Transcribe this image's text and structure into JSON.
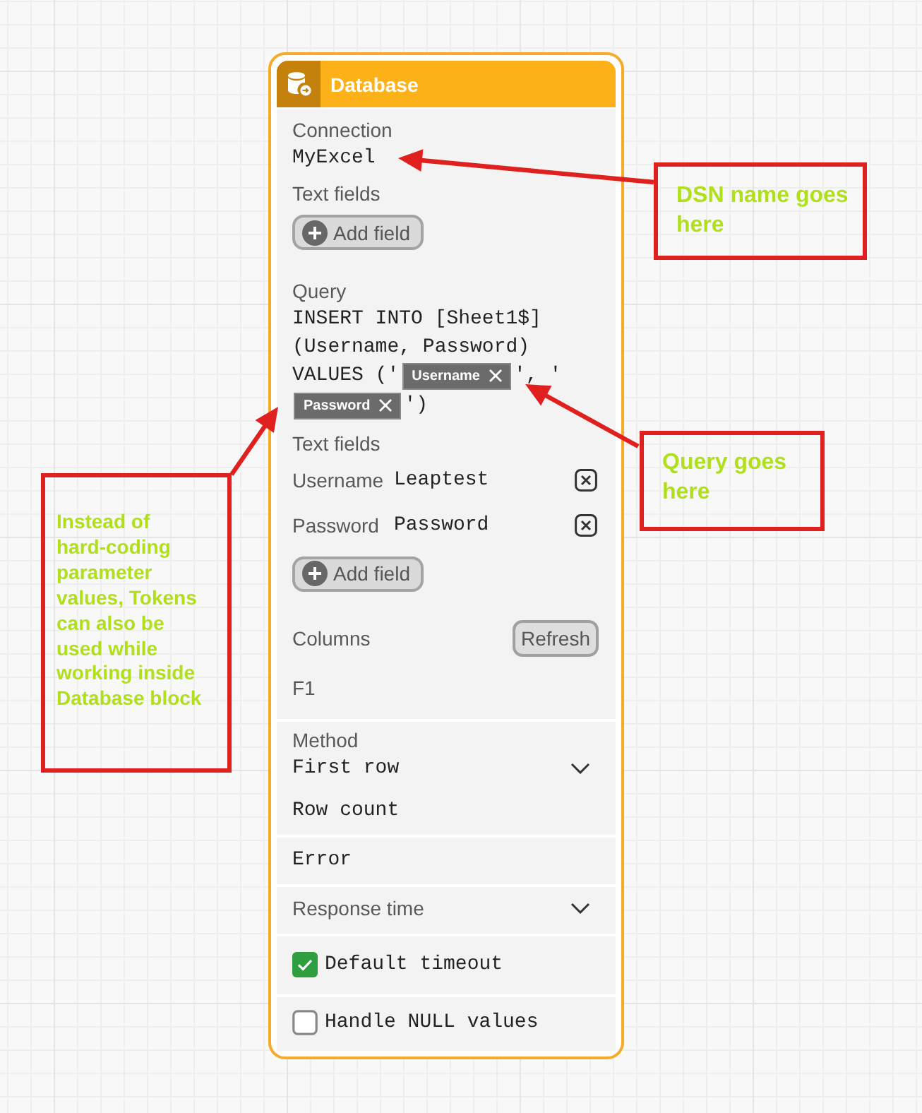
{
  "node": {
    "title": "Database",
    "connection": {
      "label": "Connection",
      "value": "MyExcel"
    },
    "connection_fields": {
      "label": "Text fields",
      "add_button": "Add field"
    },
    "query": {
      "label": "Query",
      "lines": [
        [
          {
            "kind": "text",
            "text": "INSERT INTO [Sheet1$]"
          }
        ],
        [
          {
            "kind": "text",
            "text": "(Username, Password)"
          }
        ],
        [
          {
            "kind": "text",
            "text": "VALUES ('"
          },
          {
            "kind": "token",
            "text": "Username"
          },
          {
            "kind": "text",
            "text": "', '"
          }
        ],
        [
          {
            "kind": "token",
            "text": "Password"
          },
          {
            "kind": "text",
            "text": "')"
          }
        ]
      ]
    },
    "query_fields": {
      "label": "Text fields",
      "rows": [
        {
          "label": "Username",
          "value": "Leaptest"
        },
        {
          "label": "Password",
          "value": "Password"
        }
      ],
      "add_button": "Add field"
    },
    "columns": {
      "label": "Columns",
      "refresh_button": "Refresh",
      "items": [
        "F1"
      ]
    },
    "method": {
      "label": "Method",
      "value": "First row",
      "output": "Row count"
    },
    "error": "Error",
    "response_time": {
      "label": "Response time"
    },
    "options": [
      {
        "label": "Default timeout",
        "checked": true
      },
      {
        "label": "Handle NULL values",
        "checked": false
      }
    ]
  },
  "annotations": [
    {
      "text": "DSN name goes here"
    },
    {
      "text": "Query goes here"
    },
    {
      "text": "Instead of hard-coding parameter values, Tokens can also be used while working inside Database block"
    }
  ]
}
